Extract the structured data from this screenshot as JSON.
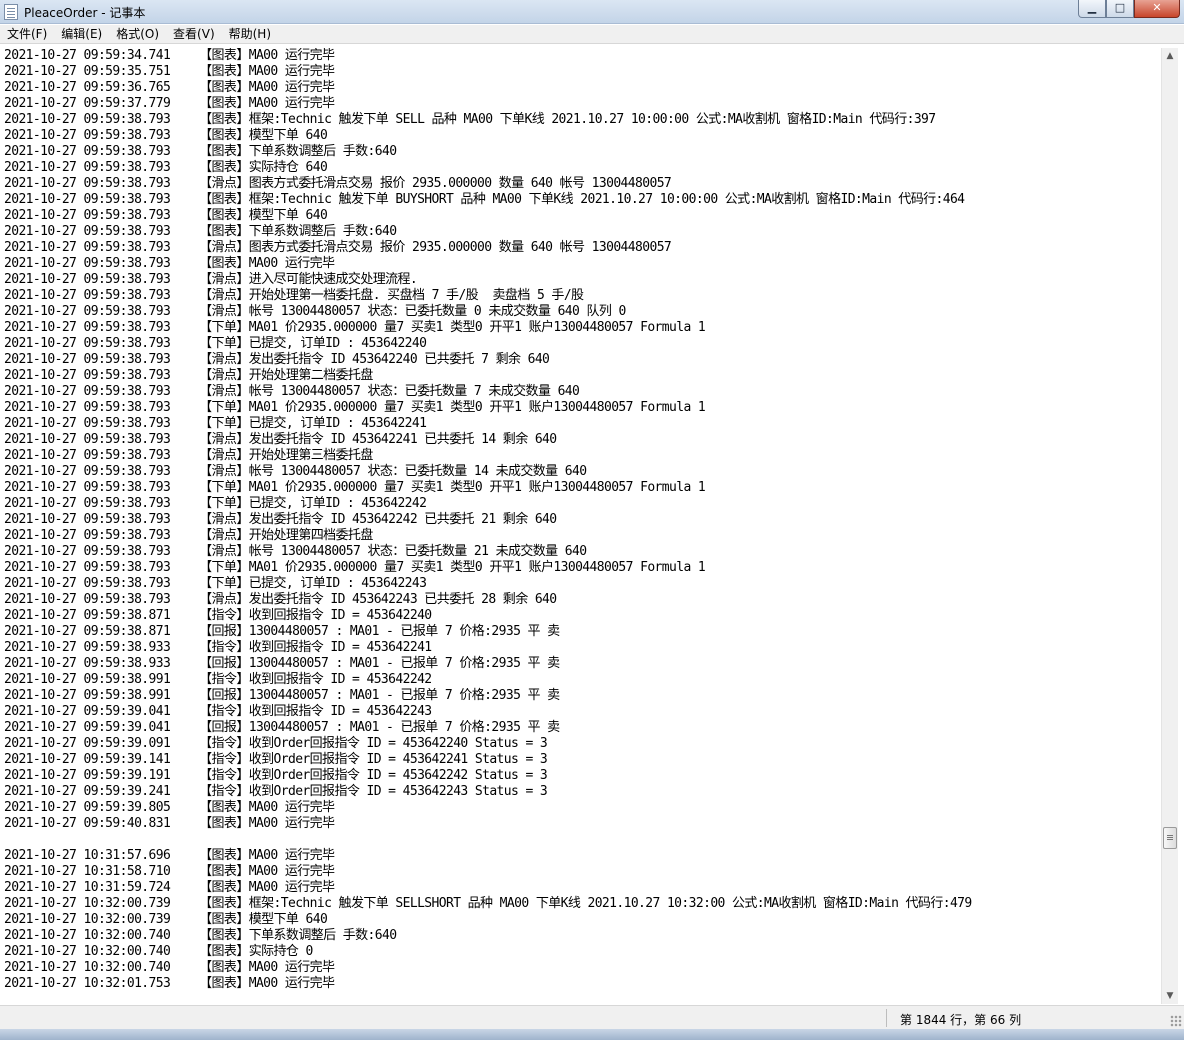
{
  "window": {
    "title": "PleaceOrder - 记事本",
    "minimize_label": "▁",
    "maximize_label": "□",
    "close_label": "✕"
  },
  "menu": [
    {
      "label": "文件(F)"
    },
    {
      "label": "编辑(E)"
    },
    {
      "label": "格式(O)"
    },
    {
      "label": "查看(V)"
    },
    {
      "label": "帮助(H)"
    }
  ],
  "lines": [
    "2021-10-27 09:59:34.741    【图表】MA00 运行完毕",
    "2021-10-27 09:59:35.751    【图表】MA00 运行完毕",
    "2021-10-27 09:59:36.765    【图表】MA00 运行完毕",
    "2021-10-27 09:59:37.779    【图表】MA00 运行完毕",
    "2021-10-27 09:59:38.793    【图表】框架:Technic 触发下单 SELL 品种 MA00 下单K线 2021.10.27 10:00:00 公式:MA收割机 窗格ID:Main 代码行:397",
    "2021-10-27 09:59:38.793    【图表】模型下单 640",
    "2021-10-27 09:59:38.793    【图表】下单系数调整后 手数:640",
    "2021-10-27 09:59:38.793    【图表】实际持仓 640",
    "2021-10-27 09:59:38.793    【滑点】图表方式委托滑点交易 报价 2935.000000 数量 640 帐号 13004480057",
    "2021-10-27 09:59:38.793    【图表】框架:Technic 触发下单 BUYSHORT 品种 MA00 下单K线 2021.10.27 10:00:00 公式:MA收割机 窗格ID:Main 代码行:464",
    "2021-10-27 09:59:38.793    【图表】模型下单 640",
    "2021-10-27 09:59:38.793    【图表】下单系数调整后 手数:640",
    "2021-10-27 09:59:38.793    【滑点】图表方式委托滑点交易 报价 2935.000000 数量 640 帐号 13004480057",
    "2021-10-27 09:59:38.793    【图表】MA00 运行完毕",
    "2021-10-27 09:59:38.793    【滑点】进入尽可能快速成交处理流程.",
    "2021-10-27 09:59:38.793    【滑点】开始处理第一档委托盘. 买盘档 7 手/股  卖盘档 5 手/股",
    "2021-10-27 09:59:38.793    【滑点】帐号 13004480057 状态：已委托数量 0 未成交数量 640 队列 0",
    "2021-10-27 09:59:38.793    【下单】MA01 价2935.000000 量7 买卖1 类型0 开平1 账户13004480057 Formula 1",
    "2021-10-27 09:59:38.793    【下单】已提交, 订单ID : 453642240",
    "2021-10-27 09:59:38.793    【滑点】发出委托指令 ID 453642240 已共委托 7 剩余 640",
    "2021-10-27 09:59:38.793    【滑点】开始处理第二档委托盘",
    "2021-10-27 09:59:38.793    【滑点】帐号 13004480057 状态：已委托数量 7 未成交数量 640",
    "2021-10-27 09:59:38.793    【下单】MA01 价2935.000000 量7 买卖1 类型0 开平1 账户13004480057 Formula 1",
    "2021-10-27 09:59:38.793    【下单】已提交, 订单ID : 453642241",
    "2021-10-27 09:59:38.793    【滑点】发出委托指令 ID 453642241 已共委托 14 剩余 640",
    "2021-10-27 09:59:38.793    【滑点】开始处理第三档委托盘",
    "2021-10-27 09:59:38.793    【滑点】帐号 13004480057 状态：已委托数量 14 未成交数量 640",
    "2021-10-27 09:59:38.793    【下单】MA01 价2935.000000 量7 买卖1 类型0 开平1 账户13004480057 Formula 1",
    "2021-10-27 09:59:38.793    【下单】已提交, 订单ID : 453642242",
    "2021-10-27 09:59:38.793    【滑点】发出委托指令 ID 453642242 已共委托 21 剩余 640",
    "2021-10-27 09:59:38.793    【滑点】开始处理第四档委托盘",
    "2021-10-27 09:59:38.793    【滑点】帐号 13004480057 状态：已委托数量 21 未成交数量 640",
    "2021-10-27 09:59:38.793    【下单】MA01 价2935.000000 量7 买卖1 类型0 开平1 账户13004480057 Formula 1",
    "2021-10-27 09:59:38.793    【下单】已提交, 订单ID : 453642243",
    "2021-10-27 09:59:38.793    【滑点】发出委托指令 ID 453642243 已共委托 28 剩余 640",
    "2021-10-27 09:59:38.871    【指令】收到回报指令 ID = 453642240",
    "2021-10-27 09:59:38.871    【回报】13004480057 : MA01 - 已报单 7 价格:2935 平 卖",
    "2021-10-27 09:59:38.933    【指令】收到回报指令 ID = 453642241",
    "2021-10-27 09:59:38.933    【回报】13004480057 : MA01 - 已报单 7 价格:2935 平 卖",
    "2021-10-27 09:59:38.991    【指令】收到回报指令 ID = 453642242",
    "2021-10-27 09:59:38.991    【回报】13004480057 : MA01 - 已报单 7 价格:2935 平 卖",
    "2021-10-27 09:59:39.041    【指令】收到回报指令 ID = 453642243",
    "2021-10-27 09:59:39.041    【回报】13004480057 : MA01 - 已报单 7 价格:2935 平 卖",
    "2021-10-27 09:59:39.091    【指令】收到Order回报指令 ID = 453642240 Status = 3",
    "2021-10-27 09:59:39.141    【指令】收到Order回报指令 ID = 453642241 Status = 3",
    "2021-10-27 09:59:39.191    【指令】收到Order回报指令 ID = 453642242 Status = 3",
    "2021-10-27 09:59:39.241    【指令】收到Order回报指令 ID = 453642243 Status = 3",
    "2021-10-27 09:59:39.805    【图表】MA00 运行完毕",
    "2021-10-27 09:59:40.831    【图表】MA00 运行完毕",
    "",
    "2021-10-27 10:31:57.696    【图表】MA00 运行完毕",
    "2021-10-27 10:31:58.710    【图表】MA00 运行完毕",
    "2021-10-27 10:31:59.724    【图表】MA00 运行完毕",
    "2021-10-27 10:32:00.739    【图表】框架:Technic 触发下单 SELLSHORT 品种 MA00 下单K线 2021.10.27 10:32:00 公式:MA收割机 窗格ID:Main 代码行:479",
    "2021-10-27 10:32:00.739    【图表】模型下单 640",
    "2021-10-27 10:32:00.740    【图表】下单系数调整后 手数:640",
    "2021-10-27 10:32:00.740    【图表】实际持仓 0",
    "2021-10-27 10:32:00.740    【图表】MA00 运行完毕",
    "2021-10-27 10:32:01.753    【图表】MA00 运行完毕"
  ],
  "status": {
    "position": "第 1844 行，第 66 列"
  },
  "icons": {
    "app": "notepad-icon",
    "scroll_up": "chevron-up-icon",
    "scroll_down": "chevron-down-icon",
    "grip": "size-grip-icon"
  }
}
